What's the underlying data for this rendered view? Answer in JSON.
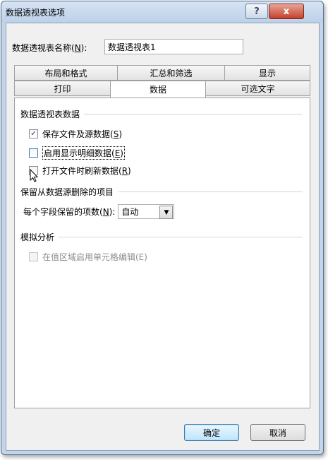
{
  "window": {
    "title": "数据透视表选项",
    "help_label": "?",
    "close_label": "x"
  },
  "name": {
    "label_prefix": "数据透视表名称(",
    "hotkey": "N",
    "label_suffix": "):",
    "value": "数据透视表1"
  },
  "tabs_row1": [
    "布局和格式",
    "汇总和筛选",
    "显示"
  ],
  "tabs_row2": [
    "打印",
    "数据",
    "可选文字"
  ],
  "active_tab": "数据",
  "section_data": {
    "header": "数据透视表数据",
    "options": [
      {
        "prefix": "保存文件及源数据(",
        "hotkey": "S",
        "suffix": ")",
        "checked": true
      },
      {
        "prefix": "启用显示明细数据(",
        "hotkey": "E",
        "suffix": ")",
        "checked": false
      },
      {
        "prefix": "打开文件时刷新数据(",
        "hotkey": "R",
        "suffix": ")",
        "checked": false
      }
    ]
  },
  "section_retain": {
    "header": "保留从数据源删除的项目",
    "label_prefix": "每个字段保留的项数(",
    "hotkey": "N",
    "label_suffix": "):",
    "selected": "自动"
  },
  "section_whatif": {
    "header": "模拟分析",
    "option": "在值区域启用单元格编辑(E)",
    "checked": false,
    "disabled": true
  },
  "buttons": {
    "ok": "确定",
    "cancel": "取消"
  }
}
